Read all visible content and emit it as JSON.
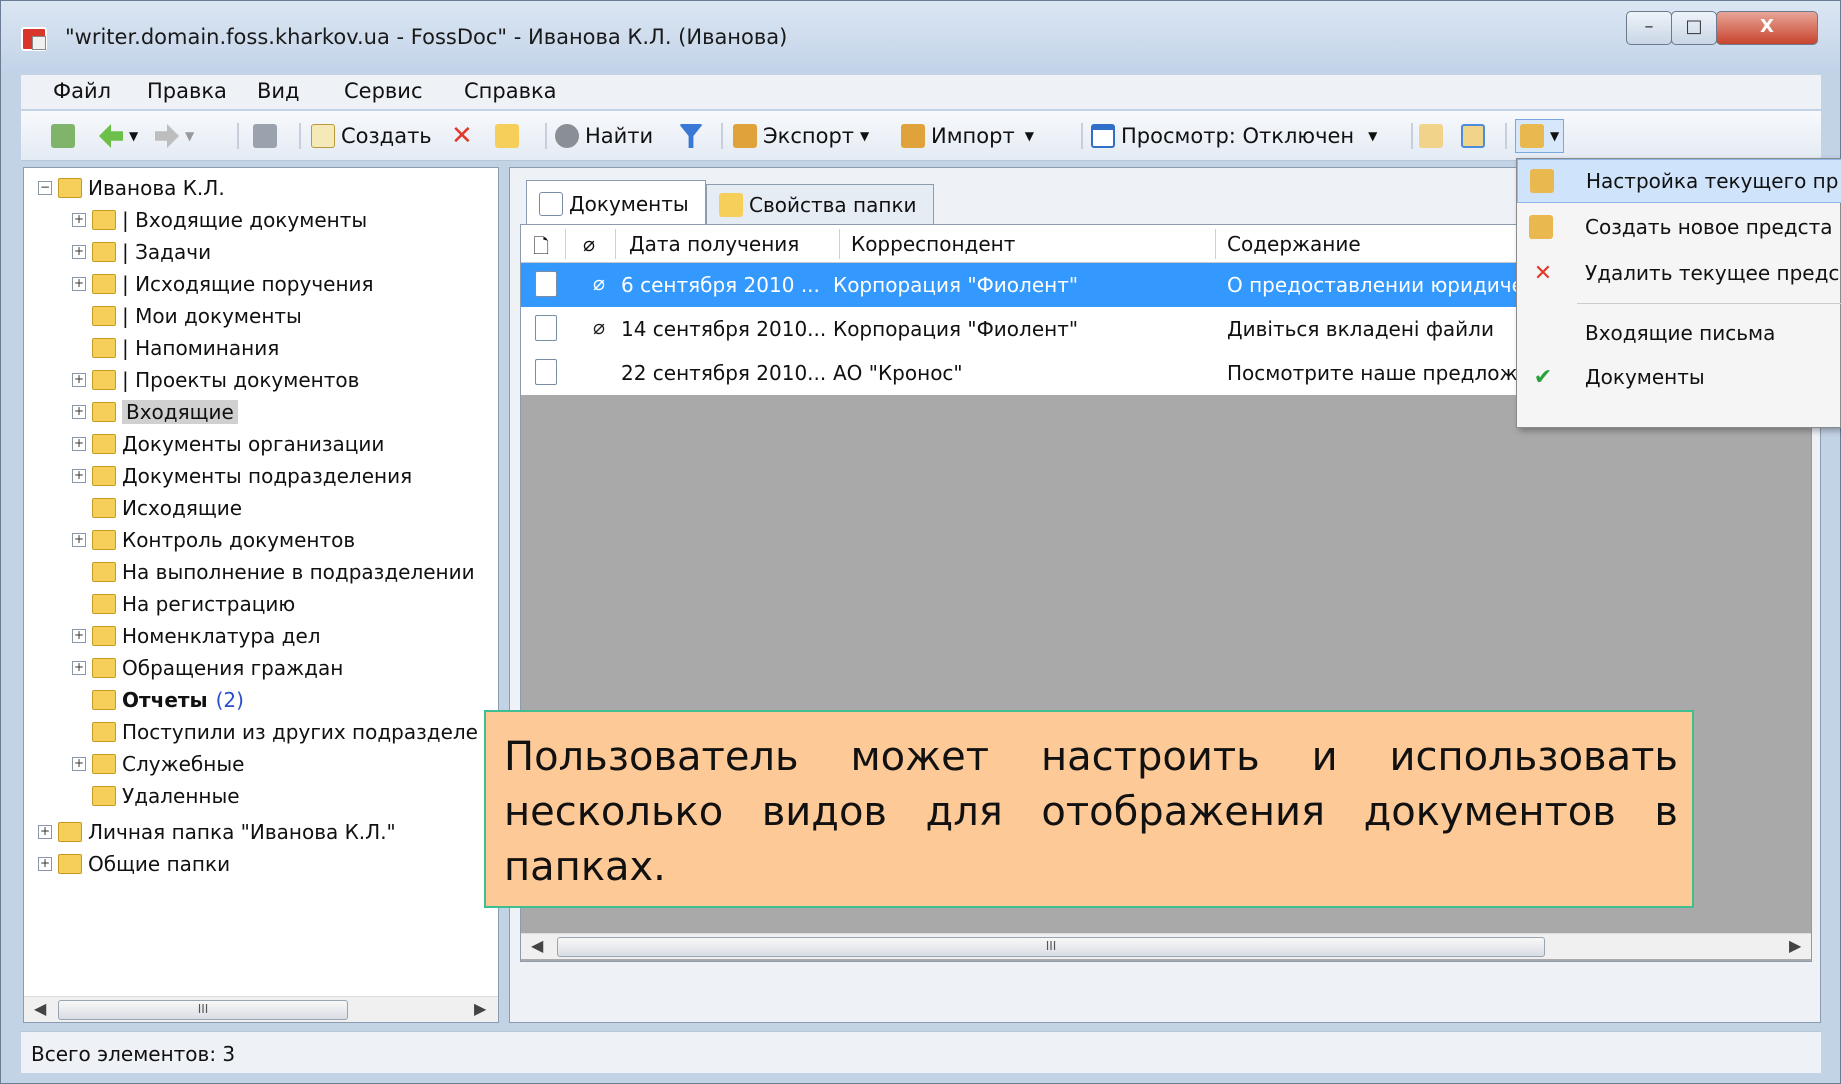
{
  "window": {
    "title": "\"writer.domain.foss.kharkov.ua - FossDoc\" - Иванова К.Л. (Иванова)",
    "controls": {
      "min": "–",
      "max": "□",
      "close": "X"
    }
  },
  "menu": [
    "Файл",
    "Правка",
    "Вид",
    "Сервис",
    "Справка"
  ],
  "toolbar": {
    "create": "Создать",
    "find": "Найти",
    "export": "Экспорт",
    "import": "Импорт",
    "preview": "Просмотр: Отключен"
  },
  "tree": [
    {
      "label": "Иванова К.Л.",
      "level": 0,
      "expand": "minus",
      "icon": "user-folder-icon"
    },
    {
      "label": "| Входящие документы",
      "level": 1,
      "expand": "plus",
      "icon": "inbox-folder-icon"
    },
    {
      "label": "| Задачи",
      "level": 1,
      "expand": "plus",
      "icon": "tasks-folder-icon"
    },
    {
      "label": "| Исходящие поручения",
      "level": 1,
      "expand": "plus",
      "icon": "outgoing-folder-icon"
    },
    {
      "label": "| Мои документы",
      "level": 1,
      "expand": "none",
      "icon": "my-docs-folder-icon"
    },
    {
      "label": "| Напоминания",
      "level": 1,
      "expand": "none",
      "icon": "reminders-folder-icon"
    },
    {
      "label": "| Проекты документов",
      "level": 1,
      "expand": "plus",
      "icon": "drafts-folder-icon"
    },
    {
      "label": "Входящие",
      "level": 1,
      "expand": "plus",
      "icon": "shared-folder-icon",
      "selected": true
    },
    {
      "label": "Документы организации",
      "level": 1,
      "expand": "plus",
      "icon": "shared-folder-icon"
    },
    {
      "label": "Документы подразделения",
      "level": 1,
      "expand": "plus",
      "icon": "shared-folder-icon"
    },
    {
      "label": "Исходящие",
      "level": 1,
      "expand": "none",
      "icon": "shared-folder-icon"
    },
    {
      "label": "Контроль документов",
      "level": 1,
      "expand": "plus",
      "icon": "shared-folder-icon"
    },
    {
      "label": "На выполнение в подразделении",
      "level": 1,
      "expand": "none",
      "icon": "shared-folder-icon"
    },
    {
      "label": "На регистрацию",
      "level": 1,
      "expand": "none",
      "icon": "shared-folder-icon"
    },
    {
      "label": "Номенклатура дел",
      "level": 1,
      "expand": "plus",
      "icon": "shared-folder-icon"
    },
    {
      "label": "Обращения граждан",
      "level": 1,
      "expand": "plus",
      "icon": "shared-folder-icon"
    },
    {
      "label": "Отчеты",
      "level": 1,
      "expand": "none",
      "icon": "shared-folder-icon",
      "bold": true,
      "count": "(2)"
    },
    {
      "label": "Поступили из других подразделе",
      "level": 1,
      "expand": "none",
      "icon": "shared-folder-icon"
    },
    {
      "label": "Служебные",
      "level": 1,
      "expand": "plus",
      "icon": "shared-folder-icon"
    },
    {
      "label": "Удаленные",
      "level": 1,
      "expand": "none",
      "icon": "deleted-folder-icon"
    },
    {
      "label": "Личная папка \"Иванова К.Л.\"",
      "level": 0,
      "expand": "plus",
      "icon": "personal-folder-icon"
    },
    {
      "label": "Общие папки",
      "level": 0,
      "expand": "plus",
      "icon": "public-folder-icon"
    }
  ],
  "tabs": [
    "Документы",
    "Свойства папки"
  ],
  "grid": {
    "columns": [
      "Дата получения",
      "Корреспондент",
      "Содержание"
    ],
    "rows": [
      {
        "date": "6 сентября 2010 ...",
        "correspondent": "Корпорация \"Фиолент\"",
        "content": "О предоставлении юридическ",
        "attachment": true,
        "selected": true
      },
      {
        "date": "14 сентября 2010...",
        "correspondent": "Корпорация \"Фиолент\"",
        "content": "Дивіться вкладені файли",
        "attachment": true,
        "selected": false
      },
      {
        "date": "22 сентября 2010...",
        "correspondent": "АО \"Кронос\"",
        "content": "Посмотрите наше предложен",
        "attachment": false,
        "selected": false
      }
    ]
  },
  "dropdown": [
    {
      "label": "Настройка текущего пр",
      "icon": "view-settings-icon",
      "highlight": true
    },
    {
      "label": "Создать новое предста",
      "icon": "new-view-icon"
    },
    {
      "label": "Удалить текущее предс",
      "icon": "delete-icon"
    },
    {
      "label": "Входящие письма",
      "icon": ""
    },
    {
      "label": "Документы",
      "icon": "checkmark-icon"
    }
  ],
  "status": "Всего элементов: 3",
  "scroll_thumb": "III",
  "callout": "Пользователь может настроить и использовать несколько видов для отображения документов в папках."
}
